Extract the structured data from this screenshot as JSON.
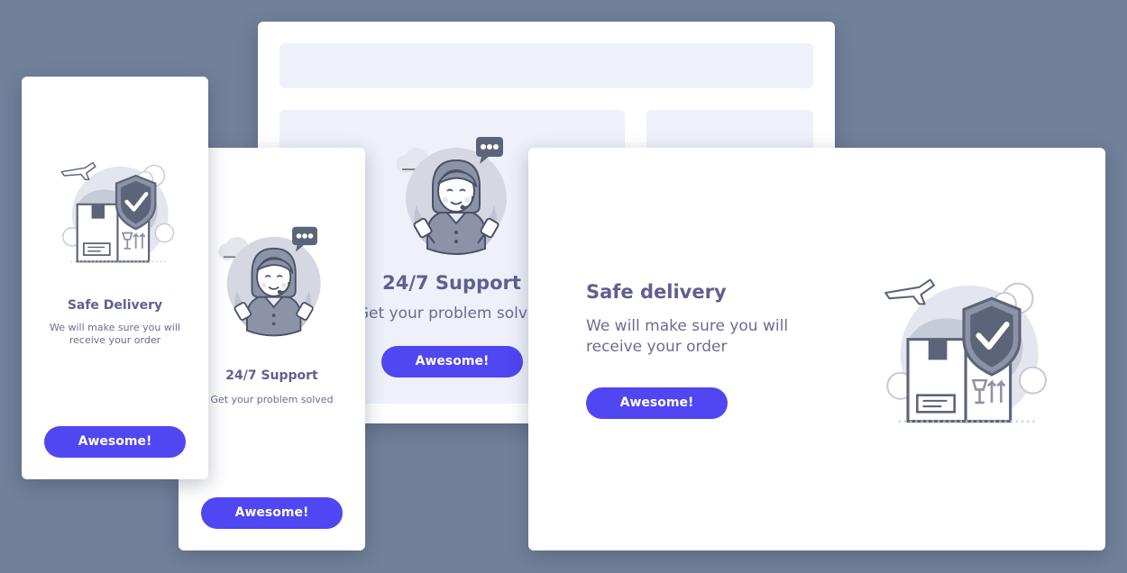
{
  "desktop_card": {
    "title": "24/7 Support",
    "description": "Get your problem solved",
    "button_label": "Awesome!"
  },
  "mobile_delivery_card": {
    "title": "Safe Delivery",
    "description_line1": "We will make sure you will",
    "description_line2": "receive your order",
    "button_label": "Awesome!"
  },
  "mobile_support_card": {
    "title": "24/7 Support",
    "description": "Get your problem solved",
    "button_label": "Awesome!"
  },
  "tablet_card": {
    "title": "Safe delivery",
    "description_line1": "We will make sure you will",
    "description_line2": "receive your order",
    "button_label": "Awesome!"
  },
  "colors": {
    "background": "#72819a",
    "button": "#5046f2",
    "title": "#5f5f92",
    "placeholder": "#eef1fa",
    "illustration": "#5c6479"
  },
  "icons": [
    "box-shield-illustration",
    "support-agent-illustration"
  ]
}
